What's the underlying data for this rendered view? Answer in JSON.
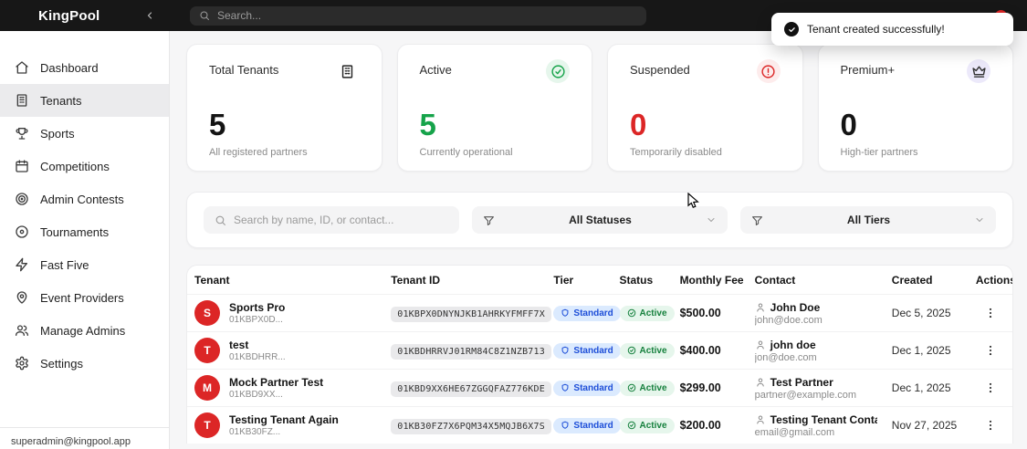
{
  "app": {
    "name": "KingPool"
  },
  "topbar": {
    "search_placeholder": "Search..."
  },
  "toast": {
    "message": "Tenant created successfully!"
  },
  "sidebar": {
    "items": [
      {
        "label": "Dashboard",
        "icon": "home"
      },
      {
        "label": "Tenants",
        "icon": "building",
        "active": true
      },
      {
        "label": "Sports",
        "icon": "trophy"
      },
      {
        "label": "Competitions",
        "icon": "calendar"
      },
      {
        "label": "Admin Contests",
        "icon": "target"
      },
      {
        "label": "Tournaments",
        "icon": "disc"
      },
      {
        "label": "Fast Five",
        "icon": "zap"
      },
      {
        "label": "Event Providers",
        "icon": "map-pin"
      },
      {
        "label": "Manage Admins",
        "icon": "users"
      },
      {
        "label": "Settings",
        "icon": "gear"
      }
    ],
    "footer_email": "superadmin@kingpool.app"
  },
  "stats": [
    {
      "label": "Total Tenants",
      "value": "5",
      "subtitle": "All registered partners",
      "icon": "building-icon"
    },
    {
      "label": "Active",
      "value": "5",
      "subtitle": "Currently operational",
      "icon": "check-circle-icon"
    },
    {
      "label": "Suspended",
      "value": "0",
      "subtitle": "Temporarily disabled",
      "icon": "alert-circle-icon"
    },
    {
      "label": "Premium+",
      "value": "0",
      "subtitle": "High-tier partners",
      "icon": "crown-icon"
    }
  ],
  "filters": {
    "search_placeholder": "Search by name, ID, or contact...",
    "status_value": "All Statuses",
    "tier_value": "All Tiers"
  },
  "table": {
    "columns": [
      "Tenant",
      "Tenant ID",
      "Tier",
      "Status",
      "Monthly Fee",
      "Contact",
      "Created",
      "Actions"
    ],
    "rows": [
      {
        "avatar": "S",
        "name": "Sports Pro",
        "short_id": "01KBPX0D...",
        "tenant_id": "01KBPX0DNYNJKB1AHRKYFMFF7X",
        "tier": "Standard",
        "status": "Active",
        "fee": "$500.00",
        "contact_name": "John Doe",
        "contact_email": "john@doe.com",
        "created": "Dec 5, 2025"
      },
      {
        "avatar": "T",
        "name": "test",
        "short_id": "01KBDHRR...",
        "tenant_id": "01KBDHRRVJ01RM84C8Z1NZB713",
        "tier": "Standard",
        "status": "Active",
        "fee": "$400.00",
        "contact_name": "john doe",
        "contact_email": "jon@doe.com",
        "created": "Dec 1, 2025"
      },
      {
        "avatar": "M",
        "name": "Mock Partner Test",
        "short_id": "01KBD9XX...",
        "tenant_id": "01KBD9XX6HE67ZGGQFAZ776KDE",
        "tier": "Standard",
        "status": "Active",
        "fee": "$299.00",
        "contact_name": "Test Partner",
        "contact_email": "partner@example.com",
        "created": "Dec 1, 2025"
      },
      {
        "avatar": "T",
        "name": "Testing Tenant Again",
        "short_id": "01KB30FZ...",
        "tenant_id": "01KB30FZ7X6PQM34X5MQJB6X7S",
        "tier": "Standard",
        "status": "Active",
        "fee": "$200.00",
        "contact_name": "Testing Tenant Contact",
        "contact_email": "email@gmail.com",
        "created": "Nov 27, 2025"
      }
    ]
  },
  "colors": {
    "topbar_bg": "#171717",
    "accent_red": "#dc2626",
    "success_green": "#16a34a",
    "tier_badge_bg": "#dbeafe",
    "tier_badge_text": "#1d4ed8",
    "status_badge_bg": "#e6f6ec",
    "status_badge_text": "#15803d",
    "sidebar_active_bg": "#ebebed",
    "premium_icon_bg": "#ece9fa"
  }
}
